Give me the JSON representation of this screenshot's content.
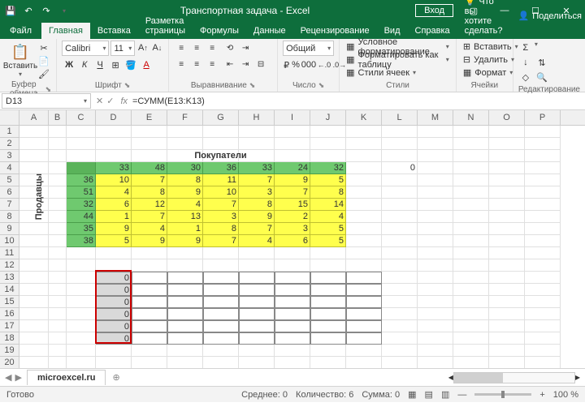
{
  "title_app": "Транспортная задача - Excel",
  "login": "Вход",
  "tabs": {
    "file": "Файл",
    "home": "Главная",
    "insert": "Вставка",
    "layout": "Разметка страницы",
    "formulas": "Формулы",
    "data": "Данные",
    "review": "Рецензирование",
    "view": "Вид",
    "help": "Справка",
    "tell": "Что вы хотите сделать?",
    "share": "Поделиться"
  },
  "ribbon": {
    "clipboard": {
      "label": "Буфер обмена",
      "paste": "Вставить"
    },
    "font": {
      "label": "Шрифт",
      "name": "Calibri",
      "size": "11"
    },
    "align": {
      "label": "Выравнивание"
    },
    "number": {
      "label": "Число",
      "format": "Общий"
    },
    "styles": {
      "label": "Стили",
      "cond": "Условное форматирование",
      "table": "Форматировать как таблицу",
      "cell": "Стили ячеек"
    },
    "cells": {
      "label": "Ячейки",
      "insert": "Вставить",
      "delete": "Удалить",
      "format": "Формат"
    },
    "editing": {
      "label": "Редактирование"
    }
  },
  "namebox": "D13",
  "formula": "=СУММ(E13:K13)",
  "cols": [
    "A",
    "B",
    "C",
    "D",
    "E",
    "F",
    "G",
    "H",
    "I",
    "J",
    "K",
    "L",
    "M",
    "N",
    "O",
    "P"
  ],
  "buyers_label": "Покупатели",
  "sellers_label": "Продавцы",
  "l_zero": "0",
  "headers_row": [
    33,
    48,
    30,
    36,
    33,
    24,
    32
  ],
  "rows": [
    [
      36,
      10,
      7,
      8,
      11,
      7,
      9,
      5
    ],
    [
      51,
      4,
      8,
      9,
      10,
      3,
      7,
      8
    ],
    [
      32,
      6,
      12,
      4,
      7,
      8,
      15,
      14
    ],
    [
      44,
      1,
      7,
      13,
      3,
      9,
      2,
      4
    ],
    [
      35,
      9,
      4,
      1,
      8,
      7,
      3,
      5
    ],
    [
      38,
      5,
      9,
      9,
      7,
      4,
      6,
      5
    ]
  ],
  "sel_vals": [
    "0",
    "0",
    "0",
    "0",
    "0",
    "0"
  ],
  "sheet_name": "microexcel.ru",
  "status": {
    "ready": "Готово",
    "avg": "Среднее: 0",
    "count": "Количество: 6",
    "sum": "Сумма: 0",
    "zoom": "100 %"
  }
}
